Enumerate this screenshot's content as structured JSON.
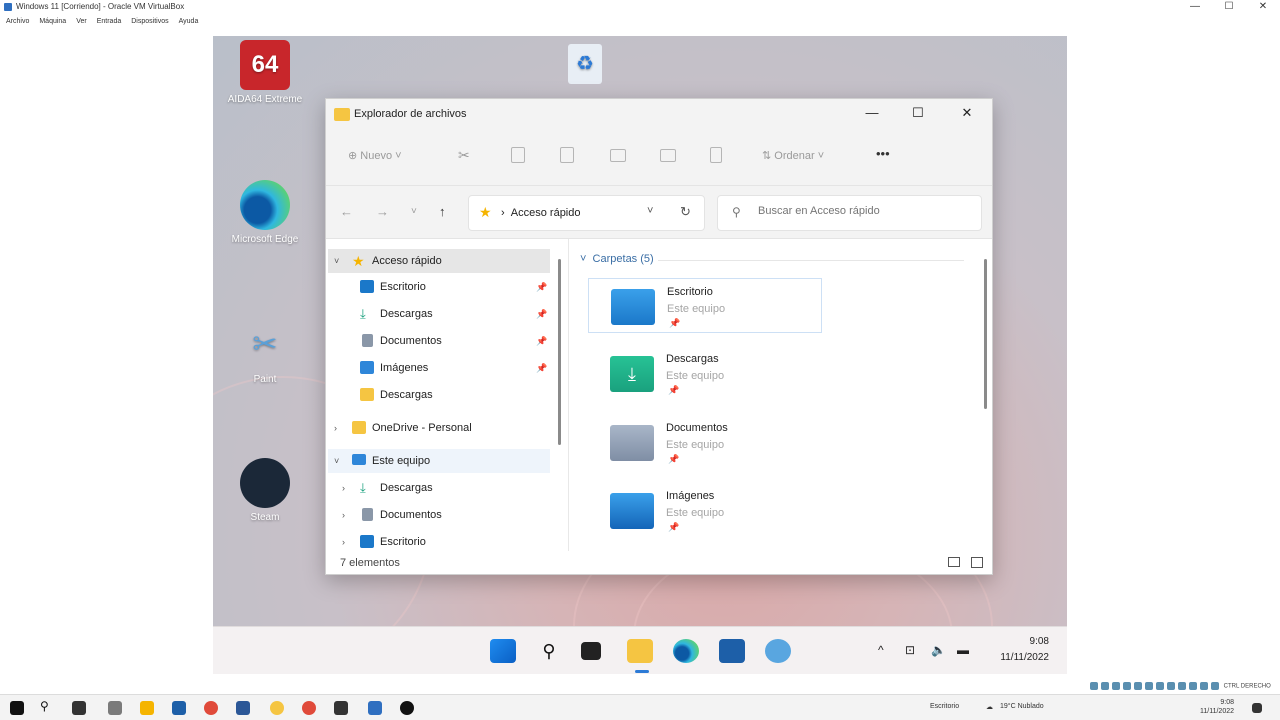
{
  "host": {
    "title": "Windows 11 [Corriendo] - Oracle VM VirtualBox",
    "controls": [
      "—",
      "☐",
      "✕"
    ],
    "menu": [
      "Archivo",
      "Máquina",
      "Ver",
      "Entrada",
      "Dispositivos",
      "Ayuda"
    ],
    "taskbar": {
      "weather": "19°C  Nublado",
      "search_label": "Escritorio",
      "time": "9:08",
      "date": "11/11/2022"
    },
    "tray_strip_label": "CTRL DERECHO"
  },
  "desktop": {
    "icons": [
      {
        "label": "AIDA64 Extreme",
        "badge": "64"
      },
      {
        "label": "Microsoft Edge"
      },
      {
        "label": "Paint"
      },
      {
        "label": "Steam"
      },
      {
        "label": "Papelera de reciclaje"
      }
    ]
  },
  "explorer": {
    "title": "Explorador de archivos",
    "toolbar": {
      "new_label": "Nuevo",
      "sort_label": "Ordenar",
      "more_label": "•••"
    },
    "address": {
      "crumb": "Acceso rápido",
      "search_placeholder": "Buscar en Acceso rápido"
    },
    "nav": {
      "quick_access": "Acceso rápido",
      "items": [
        {
          "label": "Escritorio",
          "pinned": true
        },
        {
          "label": "Descargas",
          "pinned": true
        },
        {
          "label": "Documentos",
          "pinned": true
        },
        {
          "label": "Imágenes",
          "pinned": true
        },
        {
          "label": "Descargas",
          "pinned": false
        }
      ],
      "onedrive": "OneDrive - Personal",
      "this_pc": "Este equipo",
      "pc_items": [
        "Descargas",
        "Documentos",
        "Escritorio"
      ]
    },
    "content": {
      "group_header": "Carpetas (5)",
      "tiles": [
        {
          "name": "Escritorio",
          "sub": "Este equipo"
        },
        {
          "name": "Descargas",
          "sub": "Este equipo"
        },
        {
          "name": "Documentos",
          "sub": "Este equipo"
        },
        {
          "name": "Imágenes",
          "sub": "Este equipo"
        }
      ]
    },
    "status": "7 elementos"
  },
  "guest_taskbar": {
    "time": "9:08",
    "date": "11/11/2022"
  },
  "colors": {
    "accent": "#2c7ad6",
    "folder_yellow": "#f5c542",
    "folder_teal": "#1aa17e",
    "folder_blue": "#1b78c9"
  }
}
